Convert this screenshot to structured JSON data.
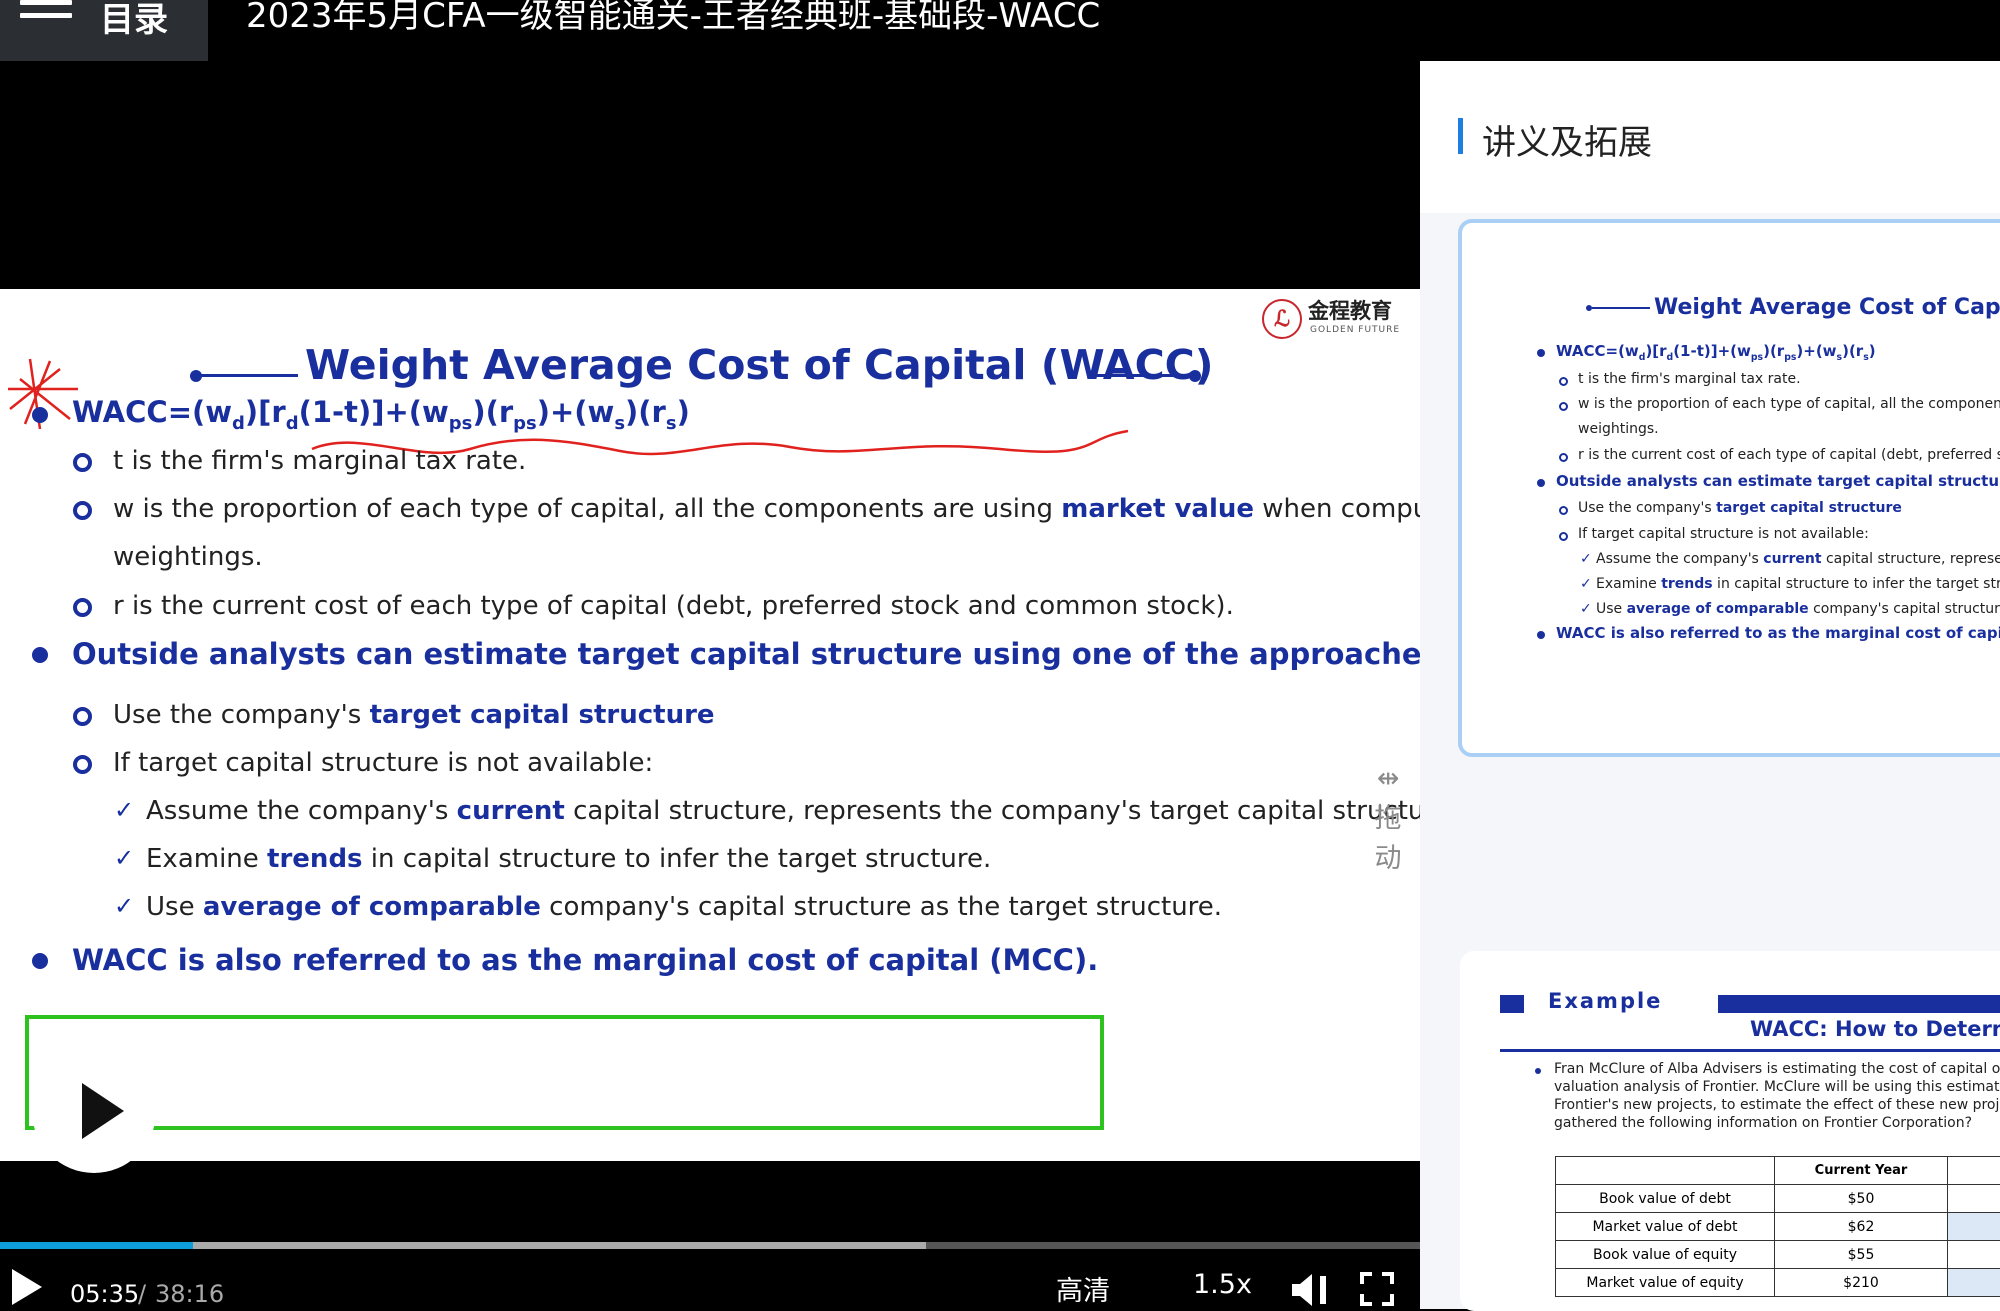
{
  "top_bar": {
    "menu_label": "目录",
    "course_title": "2023年5月CFA一级智能通关-王者经典班-基础段-WACC"
  },
  "slide": {
    "logo_cn": "金程教育",
    "logo_en": "GOLDEN FUTURE",
    "title": "Weight Average Cost of Capital (WACC)",
    "formula": {
      "p1": "WACC=(w",
      "s1": "d",
      "p2": ")[r",
      "s2": "d",
      "p3": "(1-t)]+(w",
      "s3": "ps",
      "p4": ")(r",
      "s4": "ps",
      "p5": ")+(w",
      "s5": "s",
      "p6": ")(r",
      "s6": "s",
      "p7": ")"
    },
    "items": {
      "t_def": "t is the firm's marginal tax rate.",
      "w_def_a": "w is the proportion of each type of capital, all the components are using ",
      "w_def_b": "market value",
      "w_def_c": " when computing",
      "w_def_d": "weightings.",
      "r_def": "r is the current cost of each type of capital (debt, preferred stock and common stock).",
      "outside": "Outside analysts can estimate target capital structure using one of the approaches",
      "use_a": "Use the company's ",
      "use_b": "target capital structure",
      "if_not": "If target capital structure is not available:",
      "assume_a": "Assume the company's ",
      "assume_b": "current",
      "assume_c": " capital structure, represents the company's target capital structure.",
      "examine_a": "Examine ",
      "examine_b": "trends",
      "examine_c": " in capital structure to infer the target structure.",
      "avg_a": "Use ",
      "avg_b": "average of comparable",
      "avg_c": " company's capital structure as the target structure.",
      "mcc": "WACC is also referred to as the marginal cost of capital (MCC)."
    },
    "drag_handle": {
      "label_1": "拖",
      "label_2": "动"
    }
  },
  "player": {
    "progress_fraction": 0.136,
    "buffered_fraction": 0.652,
    "time_current": "05:35",
    "time_separator": "/",
    "time_total": "38:16",
    "quality": "高清",
    "speed": "1.5x"
  },
  "panel": {
    "title": "讲义及拓展",
    "accent_color": "#1e7fe0",
    "card1": {
      "title": "Weight Average Cost of Capi",
      "formula": "WACC=(w",
      "t_def": "t is the firm's marginal tax rate.",
      "w_def": "w is the proportion of each type of capital, all the components a",
      "w_def_2": "weightings.",
      "r_def": "r is the current cost of each type of capital (debt, preferred stock",
      "outside": "Outside analysts can estimate target capital structure usi",
      "use_a": "Use the company's ",
      "use_b": "target capital structure",
      "if_not": "If target capital structure is not available:",
      "assume_a": "Assume the company's ",
      "assume_b": "current",
      "assume_c": " capital structure, represents t",
      "examine_a": "Examine ",
      "examine_b": "trends",
      "examine_c": " in capital structure to infer the target structu",
      "avg_a": "Use ",
      "avg_b": "average of comparable",
      "avg_c": " company's capital structure as t",
      "mcc": "WACC is also referred to as the marginal cost of capital (",
      "play_label": "播放"
    },
    "card2": {
      "example_label": "Example",
      "title": "WACC: How to Determine",
      "body_1": "Fran McClure of Alba Advisers is estimating the cost of capital of Fr",
      "body_2": "valuation analysis of Frontier. McClure will be using this estimate, al",
      "body_3": "Frontier's new projects, to estimate the effect of these new projects",
      "body_4": "gathered the following information on Frontier Corporation?",
      "table": {
        "header": "Current  Year",
        "rows": [
          {
            "label": "Book value of debt",
            "value": "$50"
          },
          {
            "label": "Market value of debt",
            "value": "$62"
          },
          {
            "label": "Book value of equity",
            "value": "$55"
          },
          {
            "label": "Market value of equity",
            "value": "$210"
          }
        ]
      }
    }
  }
}
